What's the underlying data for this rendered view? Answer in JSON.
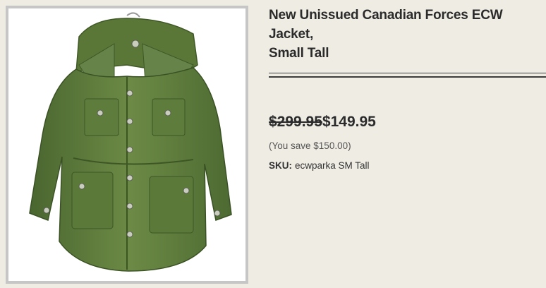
{
  "product": {
    "title": "New Unissued Canadian Forces ECW Jacket,\nSmall Tall",
    "image_alt": "olive green parka on hanger"
  },
  "pricing": {
    "old_price": "$299.95",
    "new_price": "$149.95",
    "savings": "(You save $150.00)"
  },
  "sku": {
    "label": "SKU:",
    "value": "ecwparka SM Tall"
  },
  "colors": {
    "background": "#efece4",
    "jacket_green": "#5d7a3a",
    "frame": "#c6c6c6"
  }
}
